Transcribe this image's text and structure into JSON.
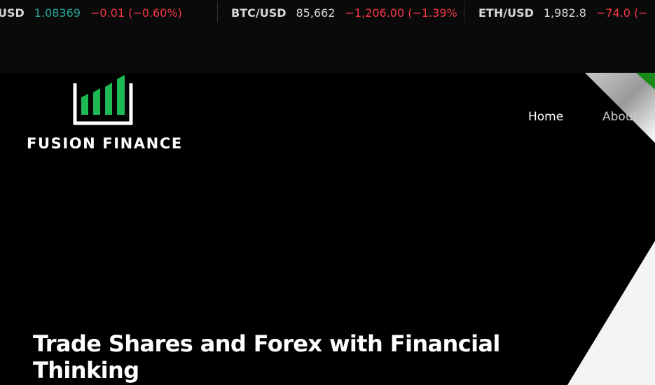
{
  "ticker": [
    {
      "symbol": "USD",
      "price": "1.08369",
      "change": "−0.01 (−0.60%)",
      "price_color": "#26a69a"
    },
    {
      "symbol": "BTC/USD",
      "price": "85,662",
      "change": "−1,206.00 (−1.39%",
      "price_color": "#d8d8d8"
    },
    {
      "symbol": "ETH/USD",
      "price": "1,982.8",
      "change": "−74.0 (−",
      "price_color": "#d8d8d8"
    }
  ],
  "brand": {
    "name": "FUSION FINANCE",
    "logo_icon": "bar-chart-logo",
    "accent_color": "#1db954"
  },
  "nav": {
    "items": [
      {
        "label": "Home"
      },
      {
        "label": "About"
      }
    ]
  },
  "hero": {
    "title": "Trade Shares and Forex with Financial Thinking"
  },
  "colors": {
    "background": "#000000",
    "ticker_background": "#0a0a0a",
    "negative": "#f23645",
    "positive": "#26a69a",
    "accent_green": "#1db954"
  }
}
